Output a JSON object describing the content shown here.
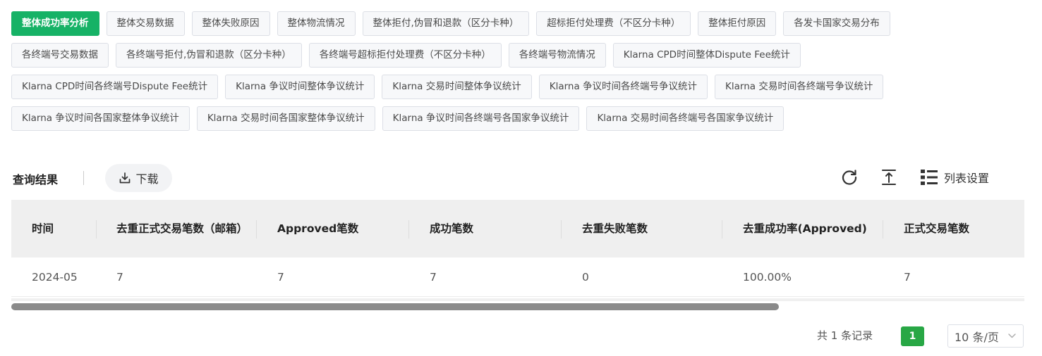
{
  "tabs": [
    [
      "整体成功率分析",
      "整体交易数据",
      "整体失败原因",
      "整体物流情况",
      "整体拒付,伪冒和退款（区分卡种）",
      "超标拒付处理费（不区分卡种）",
      "整体拒付原因",
      "各发卡国家交易分布"
    ],
    [
      "各终端号交易数据",
      "各终端号拒付,伪冒和退款（区分卡种）",
      "各终端号超标拒付处理费（不区分卡种）",
      "各终端号物流情况",
      "Klarna CPD时间整体Dispute Fee统计"
    ],
    [
      "Klarna CPD时间各终端号Dispute Fee统计",
      "Klarna 争议时间整体争议统计",
      "Klarna 交易时间整体争议统计",
      "Klarna 争议时间各终端号争议统计",
      "Klarna 交易时间各终端号争议统计"
    ],
    [
      "Klarna 争议时间各国家整体争议统计",
      "Klarna 交易时间各国家整体争议统计",
      "Klarna 争议时间各终端号各国家争议统计",
      "Klarna 交易时间各终端号各国家争议统计"
    ]
  ],
  "active_tab": "整体成功率分析",
  "colors": {
    "accent": "#16b266",
    "page_active": "#28a745"
  },
  "results": {
    "title": "查询结果",
    "download_label": "下载",
    "settings_label": "列表设置",
    "icons": [
      "download-icon",
      "refresh-icon",
      "scroll-top-icon",
      "list-settings-icon"
    ]
  },
  "table": {
    "headers": [
      "时间",
      "去重正式交易笔数（邮箱）",
      "Approved笔数",
      "成功笔数",
      "去重失败笔数",
      "去重成功率(Approved)",
      "正式交易笔数"
    ],
    "rows": [
      [
        "2024-05",
        "7",
        "7",
        "7",
        "0",
        "100.00%",
        "7"
      ]
    ]
  },
  "pagination": {
    "total_text": "共 1 条记录",
    "current_page": "1",
    "page_size": "10 条/页"
  }
}
